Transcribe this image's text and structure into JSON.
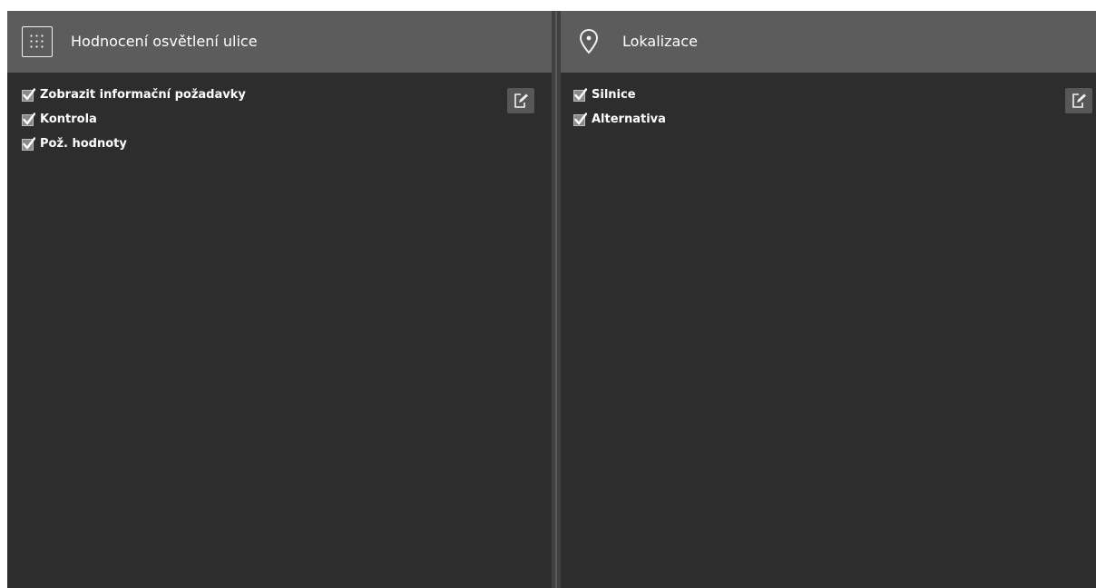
{
  "left_panel": {
    "title": "Hodnocení osvětlení ulice",
    "icon": "grid-icon",
    "items": [
      {
        "label": "Zobrazit informační požadavky",
        "checked": true
      },
      {
        "label": "Kontrola",
        "checked": true
      },
      {
        "label": "Pož. hodnoty",
        "checked": true
      }
    ],
    "action_icon": "edit-export-icon"
  },
  "right_panel": {
    "title": "Lokalizace",
    "icon": "location-pin-icon",
    "items": [
      {
        "label": "Silnice",
        "checked": true
      },
      {
        "label": "Alternativa",
        "checked": true
      }
    ],
    "action_icon": "edit-export-icon"
  },
  "colors": {
    "header": "#5c5c5c",
    "panel": "#2d2d2d",
    "text": "#ffffff",
    "button": "#575757"
  }
}
